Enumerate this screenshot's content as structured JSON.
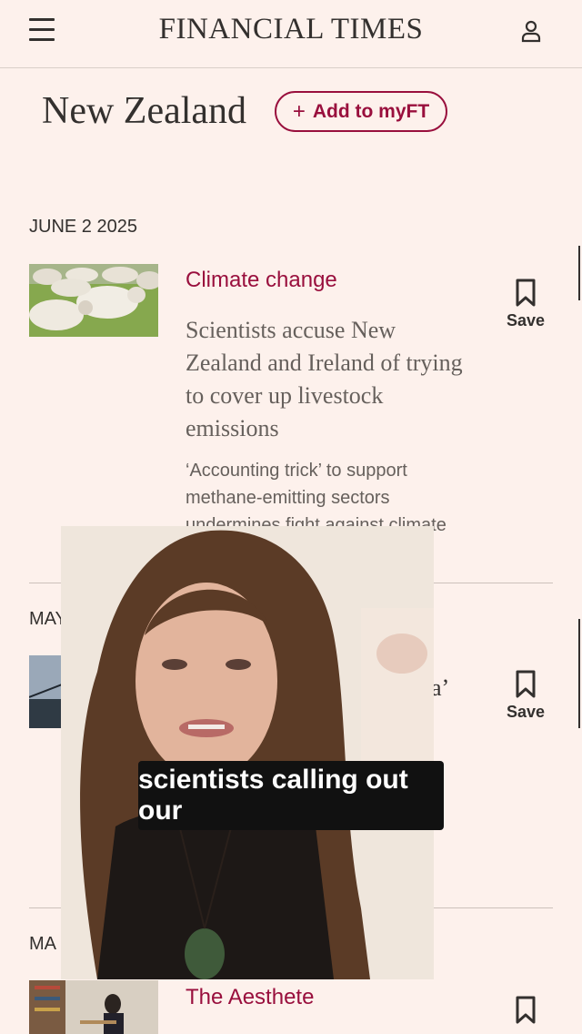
{
  "header": {
    "brand": "FINANCIAL TIMES"
  },
  "page": {
    "title": "New Zealand",
    "add_label": "Add to myFT"
  },
  "articles": [
    {
      "date": "JUNE 2 2025",
      "tag": "Climate change",
      "headline": "Scientists accuse New Zealand and Ireland of trying to cover up livestock emissions",
      "standfirst": "‘Accounting trick’ to support methane-emitting sectors undermines fight against climate change, say researchers",
      "save_label": "Save"
    },
    {
      "date": "MAY 21 2",
      "headline_fragment": "l ‘golden visa’ surge under",
      "save_label": "Save"
    },
    {
      "date": "MA",
      "tag": "The Aesthete"
    }
  ],
  "overlay": {
    "caption": "scientists calling out our"
  },
  "colors": {
    "background": "#fdf1ec",
    "accent": "#990f3d",
    "text": "#33302e"
  }
}
